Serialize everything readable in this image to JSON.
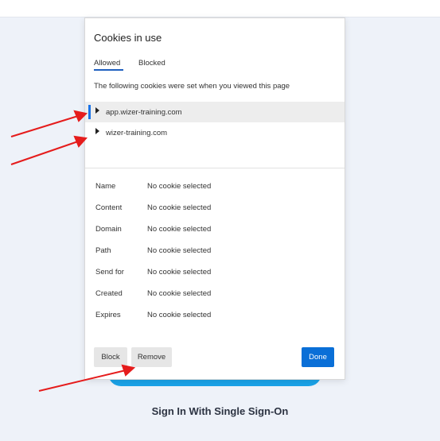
{
  "page": {
    "sso_label": "Sign In With Single Sign-On"
  },
  "dialog": {
    "title": "Cookies in use",
    "tabs": [
      {
        "label": "Allowed",
        "active": true
      },
      {
        "label": "Blocked",
        "active": false
      }
    ],
    "description": "The following cookies were set when you viewed this page",
    "cookies": [
      {
        "domain": "app.wizer-training.com",
        "selected": true
      },
      {
        "domain": "wizer-training.com",
        "selected": false
      }
    ],
    "details": [
      {
        "key": "Name",
        "value": "No cookie selected"
      },
      {
        "key": "Content",
        "value": "No cookie selected"
      },
      {
        "key": "Domain",
        "value": "No cookie selected"
      },
      {
        "key": "Path",
        "value": "No cookie selected"
      },
      {
        "key": "Send for",
        "value": "No cookie selected"
      },
      {
        "key": "Created",
        "value": "No cookie selected"
      },
      {
        "key": "Expires",
        "value": "No cookie selected"
      }
    ],
    "buttons": {
      "block": "Block",
      "remove": "Remove",
      "done": "Done"
    }
  },
  "colors": {
    "accent": "#0a6fd7",
    "annotation_arrow": "#e51c1c",
    "background_button": "#1aa3e8"
  },
  "icons": {
    "expand": "triangle-right-icon"
  }
}
